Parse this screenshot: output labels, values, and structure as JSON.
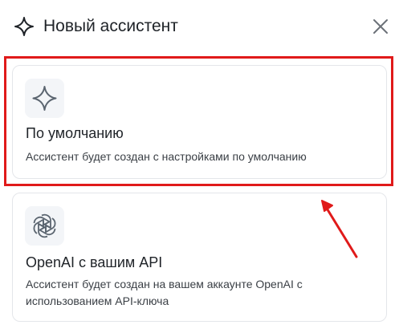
{
  "dialog": {
    "title": "Новый ассистент",
    "title_icon": "sparkle-icon",
    "close_icon": "close-icon"
  },
  "options": [
    {
      "id": "default",
      "icon": "sparkle-icon",
      "title": "По умолчанию",
      "description": "Ассистент будет создан с настройками по умолчанию",
      "highlighted": true
    },
    {
      "id": "openai",
      "icon": "openai-logo-icon",
      "title": "OpenAI с вашим API",
      "description": "Ассистент будет создан на вашем аккаунте OpenAI с использованием API-ключа",
      "highlighted": false
    }
  ],
  "colors": {
    "annotation": "#e01a1a",
    "card_border": "#e4e6ea",
    "icon_box_bg": "#f3f5f8",
    "icon_muted": "#5b6570"
  }
}
